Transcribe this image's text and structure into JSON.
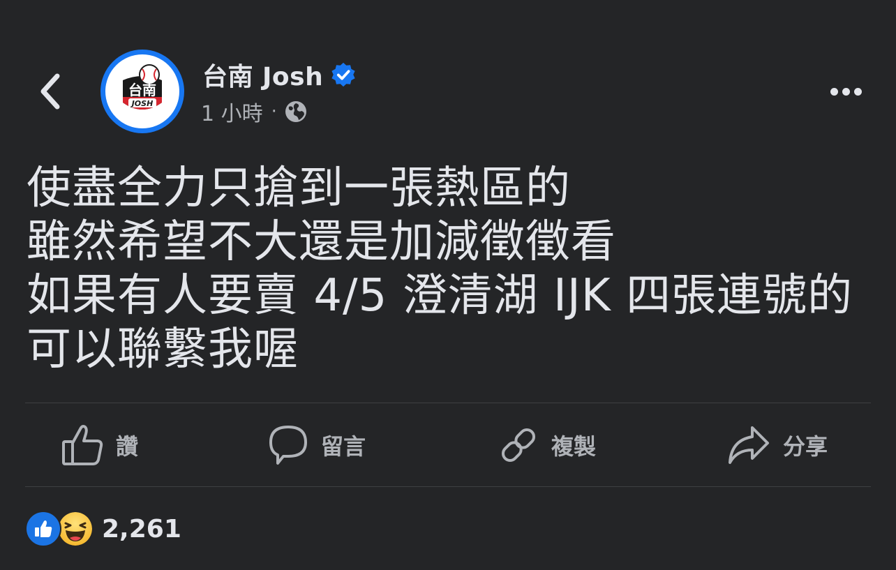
{
  "header": {
    "author_name": "台南 Josh",
    "time": "1 小時",
    "separator": "·",
    "audience_icon": "globe-icon",
    "verified_icon": "verified-badge-icon",
    "back_icon": "chevron-left-icon",
    "more_icon": "more-dots-icon",
    "avatar_logo_text": "台南",
    "avatar_logo_subtext": "JOSH"
  },
  "post": {
    "text": "使盡全力只搶到一張熱區的\n雖然希望不大還是加減徵徵看\n如果有人要賣 4/5 澄清湖 IJK 四張連號的\n可以聯繫我喔"
  },
  "actions": [
    {
      "label": "讚",
      "icon": "thumbs-up-icon"
    },
    {
      "label": "留言",
      "icon": "comment-icon"
    },
    {
      "label": "複製",
      "icon": "link-icon"
    },
    {
      "label": "分享",
      "icon": "share-icon"
    }
  ],
  "reactions": {
    "count": "2,261",
    "types": [
      "like",
      "haha"
    ]
  },
  "colors": {
    "background": "#242527",
    "text_primary": "#e4e6eb",
    "text_secondary": "#b0b3b8",
    "accent_blue": "#1877f2",
    "divider": "#3e4042"
  }
}
